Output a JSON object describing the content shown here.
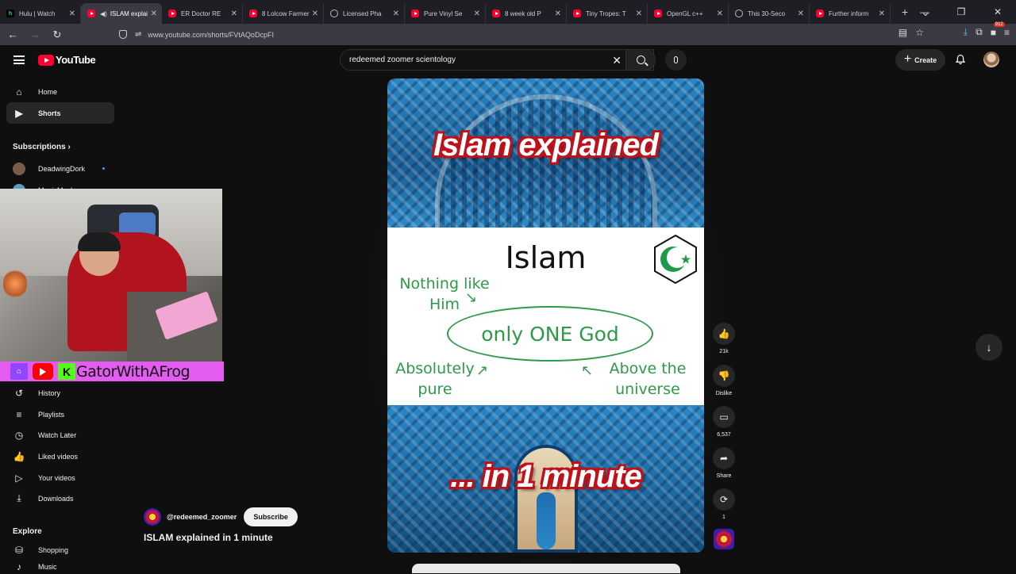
{
  "browser": {
    "tabs": [
      {
        "title": "Hulu | Watch",
        "icon": "hulu-icon",
        "active": false
      },
      {
        "title": "ISLAM explai",
        "icon": "youtube-icon",
        "active": true
      },
      {
        "title": "ER Doctor RE",
        "icon": "youtube-icon",
        "active": false
      },
      {
        "title": "8 Lolcow Farmers",
        "icon": "youtube-icon",
        "active": false
      },
      {
        "title": "Licensed Pha",
        "icon": "globe-icon",
        "active": false
      },
      {
        "title": "Pure Vinyl Se",
        "icon": "youtube-icon",
        "active": false
      },
      {
        "title": "8 week old P",
        "icon": "youtube-icon",
        "active": false
      },
      {
        "title": "Tiny Tropes: T",
        "icon": "youtube-icon",
        "active": false
      },
      {
        "title": "OpenGL c++",
        "icon": "youtube-icon",
        "active": false
      },
      {
        "title": "This 30-Seco",
        "icon": "globe-icon",
        "active": false
      },
      {
        "title": "Further inform",
        "icon": "youtube-icon",
        "active": false
      }
    ],
    "url": "www.youtube.com/shorts/FVtAQoDcpFI",
    "extension_badge": "912"
  },
  "youtube": {
    "logo_text": "YouTube",
    "search_value": "redeemed zoomer scientology",
    "create_label": "Create"
  },
  "sidebar": {
    "home": "Home",
    "shorts": "Shorts",
    "subscriptions_header": "Subscriptions",
    "subscriptions": [
      "DeadwingDork",
      "MagicMush"
    ],
    "you_items": [
      "History",
      "Playlists",
      "Watch Later",
      "Liked videos",
      "Your videos",
      "Downloads"
    ],
    "explore_header": "Explore",
    "explore_items": [
      "Shopping",
      "Music"
    ]
  },
  "overlay": {
    "streamer_name": "GatorWithAFrog"
  },
  "video": {
    "top_text": "Islam explained",
    "panel_title": "Islam",
    "note_nothing_like": "Nothing like\nHim",
    "center_text": "only ONE God",
    "note_pure": "Absolutely\npure",
    "note_above": "Above the\nuniverse",
    "bottom_text": "... in 1 minute",
    "channel": "@redeemed_zoomer",
    "subscribe_label": "Subscribe",
    "title": "ISLAM explained in 1 minute"
  },
  "actions": {
    "likes": "21k",
    "dislike_label": "Dislike",
    "comments": "6,537",
    "share_label": "Share",
    "remix_count": "1"
  }
}
